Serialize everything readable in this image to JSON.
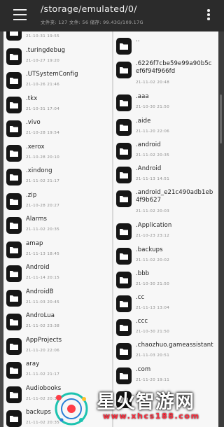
{
  "header": {
    "path": "/storage/emulated/0/",
    "subinfo": "文件夹: 127  文件: 56  储存: 99.43G/109.17G"
  },
  "left_pane": [
    {
      "name": "",
      "date": "21-10-31 19:55"
    },
    {
      "name": ".turingdebug",
      "date": "21-10-27 19:20"
    },
    {
      "name": ".UTSystemConfig",
      "date": "21-10-26 21:46"
    },
    {
      "name": ".tkx",
      "date": "21-10-31 17:04"
    },
    {
      "name": ".vivo",
      "date": "21-10-28 19:54"
    },
    {
      "name": ".xerox",
      "date": "21-10-28 20:10"
    },
    {
      "name": ".xindong",
      "date": "21-11-02 21:17"
    },
    {
      "name": ".zip",
      "date": "21-10-28 20:27"
    },
    {
      "name": "Alarms",
      "date": "21-11-02 20:35"
    },
    {
      "name": "amap",
      "date": "21-11-13 18:45"
    },
    {
      "name": "Android",
      "date": "21-11-14 20:15"
    },
    {
      "name": "AndroidB",
      "date": "21-11-03 20:45"
    },
    {
      "name": "AndroLua",
      "date": "21-11-02 23:38"
    },
    {
      "name": "AppProjects",
      "date": "21-11-20 22:06"
    },
    {
      "name": "aray",
      "date": "21-11-02 21:17"
    },
    {
      "name": "Audiobooks",
      "date": "21-11-02 20:35"
    },
    {
      "name": "backups",
      "date": "21-11-02 20:35"
    }
  ],
  "right_pane": [
    {
      "name": "..",
      "date": ""
    },
    {
      "name": ".6226f7cbe59e99a90b5cef6f94f966fd",
      "date": "21-11-02 20:48"
    },
    {
      "name": ".aaa",
      "date": "21-10-30 21:50"
    },
    {
      "name": ".aide",
      "date": "21-11-20 22:06"
    },
    {
      "name": ".android",
      "date": "21-11-02 20:35"
    },
    {
      "name": ".Android",
      "date": "21-11-13 14:51"
    },
    {
      "name": ".android_e21c490adb1eb4f9b627",
      "date": "21-11-02 20:03"
    },
    {
      "name": ".Application",
      "date": "21-10-23 23:12"
    },
    {
      "name": ".backups",
      "date": "21-11-02 20:02"
    },
    {
      "name": ".bbb",
      "date": "21-10-30 21:50"
    },
    {
      "name": ".cc",
      "date": "21-11-13 13:04"
    },
    {
      "name": ".ccc",
      "date": "21-10-30 21:50"
    },
    {
      "name": ".chaozhuo.gameassistant",
      "date": "21-11-03 20:51"
    },
    {
      "name": ".com",
      "date": "21-11-20 19:11"
    },
    {
      "name": ".",
      "date": ""
    }
  ],
  "watermark": {
    "title": "星火智游网",
    "url": "www.xhcs188.com"
  },
  "colors": {
    "appbar": "#2b2b2b",
    "pane": "#f7f7f7",
    "folder_icon": "#161616",
    "watermark_url": "#ff2b3c"
  },
  "icons": {
    "menu": "hamburger-menu-icon",
    "more": "more-vertical-icon",
    "folder": "folder-icon"
  }
}
